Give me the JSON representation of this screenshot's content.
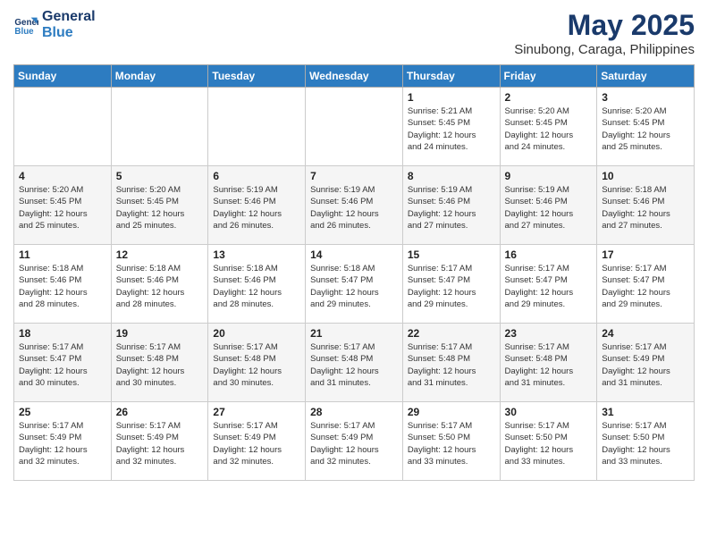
{
  "logo": {
    "line1": "General",
    "line2": "Blue"
  },
  "title": "May 2025",
  "subtitle": "Sinubong, Caraga, Philippines",
  "days_of_week": [
    "Sunday",
    "Monday",
    "Tuesday",
    "Wednesday",
    "Thursday",
    "Friday",
    "Saturday"
  ],
  "weeks": [
    [
      {
        "day": "",
        "info": ""
      },
      {
        "day": "",
        "info": ""
      },
      {
        "day": "",
        "info": ""
      },
      {
        "day": "",
        "info": ""
      },
      {
        "day": "1",
        "info": "Sunrise: 5:21 AM\nSunset: 5:45 PM\nDaylight: 12 hours\nand 24 minutes."
      },
      {
        "day": "2",
        "info": "Sunrise: 5:20 AM\nSunset: 5:45 PM\nDaylight: 12 hours\nand 24 minutes."
      },
      {
        "day": "3",
        "info": "Sunrise: 5:20 AM\nSunset: 5:45 PM\nDaylight: 12 hours\nand 25 minutes."
      }
    ],
    [
      {
        "day": "4",
        "info": "Sunrise: 5:20 AM\nSunset: 5:45 PM\nDaylight: 12 hours\nand 25 minutes."
      },
      {
        "day": "5",
        "info": "Sunrise: 5:20 AM\nSunset: 5:45 PM\nDaylight: 12 hours\nand 25 minutes."
      },
      {
        "day": "6",
        "info": "Sunrise: 5:19 AM\nSunset: 5:46 PM\nDaylight: 12 hours\nand 26 minutes."
      },
      {
        "day": "7",
        "info": "Sunrise: 5:19 AM\nSunset: 5:46 PM\nDaylight: 12 hours\nand 26 minutes."
      },
      {
        "day": "8",
        "info": "Sunrise: 5:19 AM\nSunset: 5:46 PM\nDaylight: 12 hours\nand 27 minutes."
      },
      {
        "day": "9",
        "info": "Sunrise: 5:19 AM\nSunset: 5:46 PM\nDaylight: 12 hours\nand 27 minutes."
      },
      {
        "day": "10",
        "info": "Sunrise: 5:18 AM\nSunset: 5:46 PM\nDaylight: 12 hours\nand 27 minutes."
      }
    ],
    [
      {
        "day": "11",
        "info": "Sunrise: 5:18 AM\nSunset: 5:46 PM\nDaylight: 12 hours\nand 28 minutes."
      },
      {
        "day": "12",
        "info": "Sunrise: 5:18 AM\nSunset: 5:46 PM\nDaylight: 12 hours\nand 28 minutes."
      },
      {
        "day": "13",
        "info": "Sunrise: 5:18 AM\nSunset: 5:46 PM\nDaylight: 12 hours\nand 28 minutes."
      },
      {
        "day": "14",
        "info": "Sunrise: 5:18 AM\nSunset: 5:47 PM\nDaylight: 12 hours\nand 29 minutes."
      },
      {
        "day": "15",
        "info": "Sunrise: 5:17 AM\nSunset: 5:47 PM\nDaylight: 12 hours\nand 29 minutes."
      },
      {
        "day": "16",
        "info": "Sunrise: 5:17 AM\nSunset: 5:47 PM\nDaylight: 12 hours\nand 29 minutes."
      },
      {
        "day": "17",
        "info": "Sunrise: 5:17 AM\nSunset: 5:47 PM\nDaylight: 12 hours\nand 29 minutes."
      }
    ],
    [
      {
        "day": "18",
        "info": "Sunrise: 5:17 AM\nSunset: 5:47 PM\nDaylight: 12 hours\nand 30 minutes."
      },
      {
        "day": "19",
        "info": "Sunrise: 5:17 AM\nSunset: 5:48 PM\nDaylight: 12 hours\nand 30 minutes."
      },
      {
        "day": "20",
        "info": "Sunrise: 5:17 AM\nSunset: 5:48 PM\nDaylight: 12 hours\nand 30 minutes."
      },
      {
        "day": "21",
        "info": "Sunrise: 5:17 AM\nSunset: 5:48 PM\nDaylight: 12 hours\nand 31 minutes."
      },
      {
        "day": "22",
        "info": "Sunrise: 5:17 AM\nSunset: 5:48 PM\nDaylight: 12 hours\nand 31 minutes."
      },
      {
        "day": "23",
        "info": "Sunrise: 5:17 AM\nSunset: 5:48 PM\nDaylight: 12 hours\nand 31 minutes."
      },
      {
        "day": "24",
        "info": "Sunrise: 5:17 AM\nSunset: 5:49 PM\nDaylight: 12 hours\nand 31 minutes."
      }
    ],
    [
      {
        "day": "25",
        "info": "Sunrise: 5:17 AM\nSunset: 5:49 PM\nDaylight: 12 hours\nand 32 minutes."
      },
      {
        "day": "26",
        "info": "Sunrise: 5:17 AM\nSunset: 5:49 PM\nDaylight: 12 hours\nand 32 minutes."
      },
      {
        "day": "27",
        "info": "Sunrise: 5:17 AM\nSunset: 5:49 PM\nDaylight: 12 hours\nand 32 minutes."
      },
      {
        "day": "28",
        "info": "Sunrise: 5:17 AM\nSunset: 5:49 PM\nDaylight: 12 hours\nand 32 minutes."
      },
      {
        "day": "29",
        "info": "Sunrise: 5:17 AM\nSunset: 5:50 PM\nDaylight: 12 hours\nand 33 minutes."
      },
      {
        "day": "30",
        "info": "Sunrise: 5:17 AM\nSunset: 5:50 PM\nDaylight: 12 hours\nand 33 minutes."
      },
      {
        "day": "31",
        "info": "Sunrise: 5:17 AM\nSunset: 5:50 PM\nDaylight: 12 hours\nand 33 minutes."
      }
    ]
  ]
}
